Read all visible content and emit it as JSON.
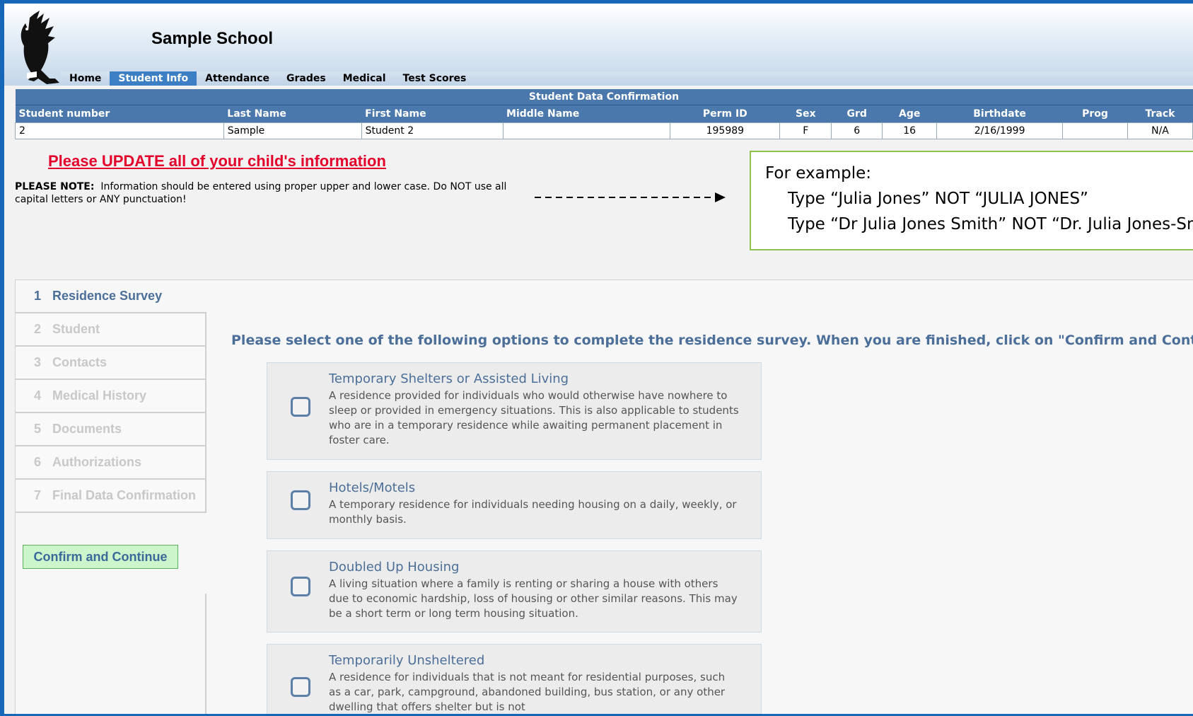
{
  "header": {
    "school_name": "Sample School",
    "logo_icon": "eagle-logo-icon"
  },
  "nav": {
    "items": [
      {
        "label": "Home",
        "active": false
      },
      {
        "label": "Student Info",
        "active": true
      },
      {
        "label": "Attendance",
        "active": false
      },
      {
        "label": "Grades",
        "active": false
      },
      {
        "label": "Medical",
        "active": false
      },
      {
        "label": "Test Scores",
        "active": false
      }
    ]
  },
  "student_table": {
    "title": "Student Data Confirmation",
    "columns": [
      "Student number",
      "Last Name",
      "First Name",
      "Middle Name",
      "Perm ID",
      "Sex",
      "Grd",
      "Age",
      "Birthdate",
      "Prog",
      "Track"
    ],
    "row": [
      "2",
      "Sample",
      "Student 2",
      "",
      "195989",
      "F",
      "6",
      "16",
      "2/16/1999",
      "",
      "N/A"
    ]
  },
  "notice": {
    "update": "Please UPDATE all of your child's information",
    "note_label": "PLEASE NOTE:",
    "note_text": "Information should be entered using proper upper and lower case.  Do NOT use all capital letters or ANY punctuation!"
  },
  "example": {
    "heading": "For example:",
    "line1": "Type “Julia Jones” NOT “JULIA JONES”",
    "line2": "Type “Dr Julia Jones Smith” NOT “Dr. Julia Jones-Smith”"
  },
  "wizard": {
    "steps": [
      {
        "num": "1",
        "label": "Residence Survey",
        "active": true
      },
      {
        "num": "2",
        "label": "Student",
        "active": false
      },
      {
        "num": "3",
        "label": "Contacts",
        "active": false
      },
      {
        "num": "4",
        "label": "Medical History",
        "active": false
      },
      {
        "num": "5",
        "label": "Documents",
        "active": false
      },
      {
        "num": "6",
        "label": "Authorizations",
        "active": false
      },
      {
        "num": "7",
        "label": "Final Data Confirmation",
        "active": false
      }
    ],
    "confirm_label": "Confirm and Continue",
    "instruction": "Please select one of the following options to complete the residence survey. When you are finished, click on \"Confirm and Continue.\"",
    "options": [
      {
        "title": "Temporary Shelters or Assisted Living",
        "description": "A residence provided for individuals who would otherwise have nowhere to sleep or provided in emergency situations. This is also applicable to students who are in a temporary residence while awaiting permanent placement in foster care.",
        "checked": false
      },
      {
        "title": "Hotels/Motels",
        "description": "A temporary residence for individuals needing housing on a daily, weekly, or monthly basis.",
        "checked": false
      },
      {
        "title": "Doubled Up Housing",
        "description": "A living situation where a family is renting or sharing a house with others due to economic hardship, loss of housing or other similar reasons. This may be a short term or long term housing situation.",
        "checked": false
      },
      {
        "title": "Temporarily Unsheltered",
        "description": "A residence for individuals that is not meant for residential purposes, such as a car, park, campground, abandoned building, bus station, or any other dwelling that offers shelter but is not",
        "checked": false
      }
    ]
  }
}
